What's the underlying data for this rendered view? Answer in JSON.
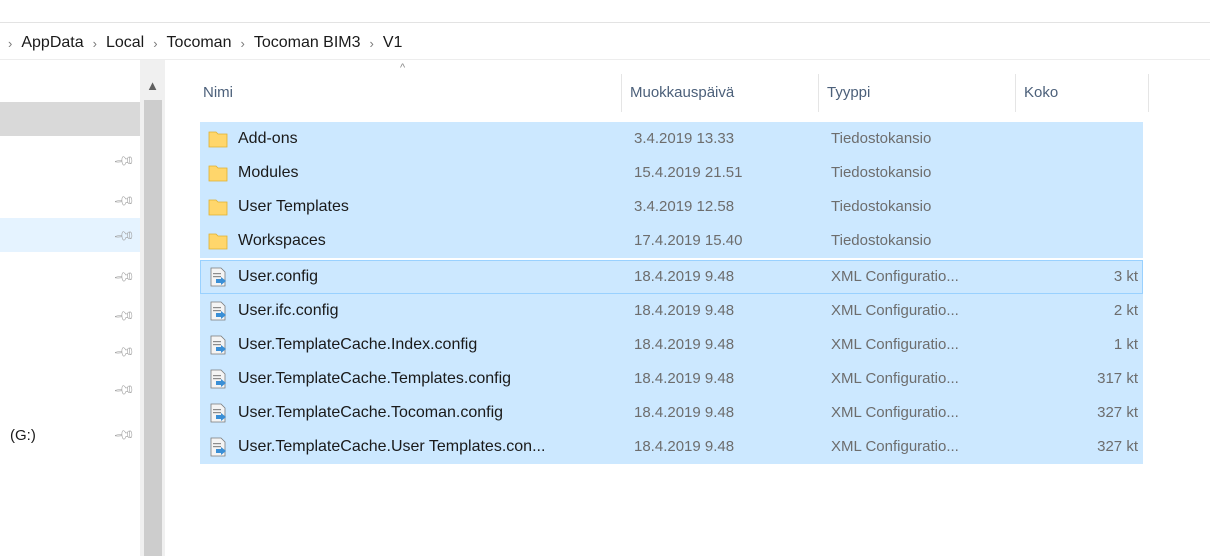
{
  "breadcrumb": [
    "AppData",
    "Local",
    "Tocoman",
    "Tocoman BIM3",
    "V1"
  ],
  "breadcrumb_separator": "›",
  "nav": {
    "drive_label": "(G:)"
  },
  "columns": {
    "name": "Nimi",
    "date": "Muokkauspäivä",
    "type": "Tyyppi",
    "size": "Koko"
  },
  "sort_indicator": "^",
  "files": [
    {
      "icon": "folder-icon",
      "name": "Add-ons",
      "date": "3.4.2019 13.33",
      "type": "Tiedostokansio",
      "size": ""
    },
    {
      "icon": "folder-icon",
      "name": "Modules",
      "date": "15.4.2019 21.51",
      "type": "Tiedostokansio",
      "size": ""
    },
    {
      "icon": "folder-icon",
      "name": "User Templates",
      "date": "3.4.2019 12.58",
      "type": "Tiedostokansio",
      "size": ""
    },
    {
      "icon": "folder-icon",
      "name": "Workspaces",
      "date": "17.4.2019 15.40",
      "type": "Tiedostokansio",
      "size": ""
    },
    {
      "icon": "xml-config-file-icon",
      "name": "User.config",
      "date": "18.4.2019 9.48",
      "type": "XML Configuratio...",
      "size": "3 kt"
    },
    {
      "icon": "xml-config-file-icon",
      "name": "User.ifc.config",
      "date": "18.4.2019 9.48",
      "type": "XML Configuratio...",
      "size": "2 kt"
    },
    {
      "icon": "xml-config-file-icon",
      "name": "User.TemplateCache.Index.config",
      "date": "18.4.2019 9.48",
      "type": "XML Configuratio...",
      "size": "1 kt"
    },
    {
      "icon": "xml-config-file-icon",
      "name": "User.TemplateCache.Templates.config",
      "date": "18.4.2019 9.48",
      "type": "XML Configuratio...",
      "size": "317 kt"
    },
    {
      "icon": "xml-config-file-icon",
      "name": "User.TemplateCache.Tocoman.config",
      "date": "18.4.2019 9.48",
      "type": "XML Configuratio...",
      "size": "327 kt"
    },
    {
      "icon": "xml-config-file-icon",
      "name": "User.TemplateCache.User Templates.con...",
      "date": "18.4.2019 9.48",
      "type": "XML Configuratio...",
      "size": "327 kt"
    }
  ],
  "colors": {
    "selection": "#cce8ff",
    "selection_border": "#99d1ff",
    "header_text": "#4c607a",
    "folder": "#ffd66b"
  }
}
